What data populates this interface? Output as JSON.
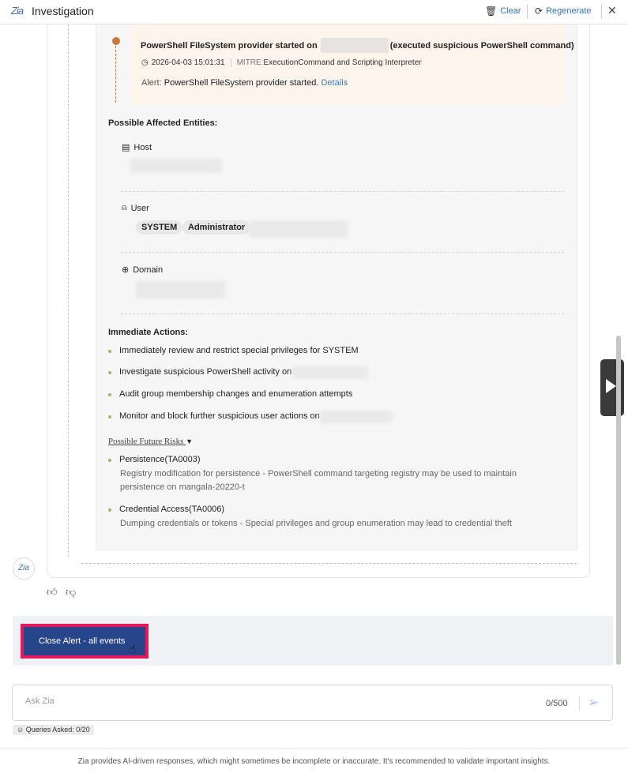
{
  "header": {
    "logo": "Zia",
    "title": "Investigation",
    "clear_label": "Clear",
    "regenerate_label": "Regenerate",
    "close_glyph": "✕"
  },
  "event": {
    "title_prefix": "PowerShell FileSystem provider started on",
    "title_suffix": "(executed suspicious PowerShell command)",
    "timestamp": "2026-04-03 15:01:31",
    "mitre_label": "MITRE:",
    "mitre_value": "ExecutionCommand and Scripting Interpreter",
    "alert_label": "Alert:",
    "alert_text": "PowerShell FileSystem provider started.",
    "details_link": "Details"
  },
  "entities": {
    "heading": "Possible Affected Entities:",
    "host_label": "Host",
    "user_label": "User",
    "user_chips": [
      "SYSTEM",
      "Administrator"
    ],
    "domain_label": "Domain"
  },
  "actions": {
    "heading": "Immediate Actions:",
    "items": [
      "Immediately review and restrict special privileges for SYSTEM",
      "Investigate suspicious PowerShell activity on",
      "Audit group membership changes and enumeration attempts",
      "Monitor and block further suspicious user actions on"
    ]
  },
  "risks": {
    "heading": "Possible Future Risks",
    "items": [
      {
        "title": "Persistence(TA0003)",
        "desc": "Registry modification for persistence - PowerShell command targeting registry may be used to maintain persistence on mangala-20220-t"
      },
      {
        "title": "Credential Access(TA0006)",
        "desc": "Dumping credentials or tokens - Special privileges and group enumeration may lead to credential theft"
      }
    ]
  },
  "avatar": "Zia",
  "primary_action": "Close Alert - all events",
  "input": {
    "placeholder": "Ask Zia",
    "counter": "0/500"
  },
  "queries": "Queries Asked: 0/20",
  "footer": "Zia provides AI-driven responses, which might sometimes be incomplete or inaccurate. It's recommended to validate important insights.",
  "colors": {
    "action_button": "#26458a",
    "highlight_border": "#e6185b",
    "timeline": "#c77a3a",
    "bullet": "#8fbf5a",
    "link": "#3b7bc7"
  }
}
